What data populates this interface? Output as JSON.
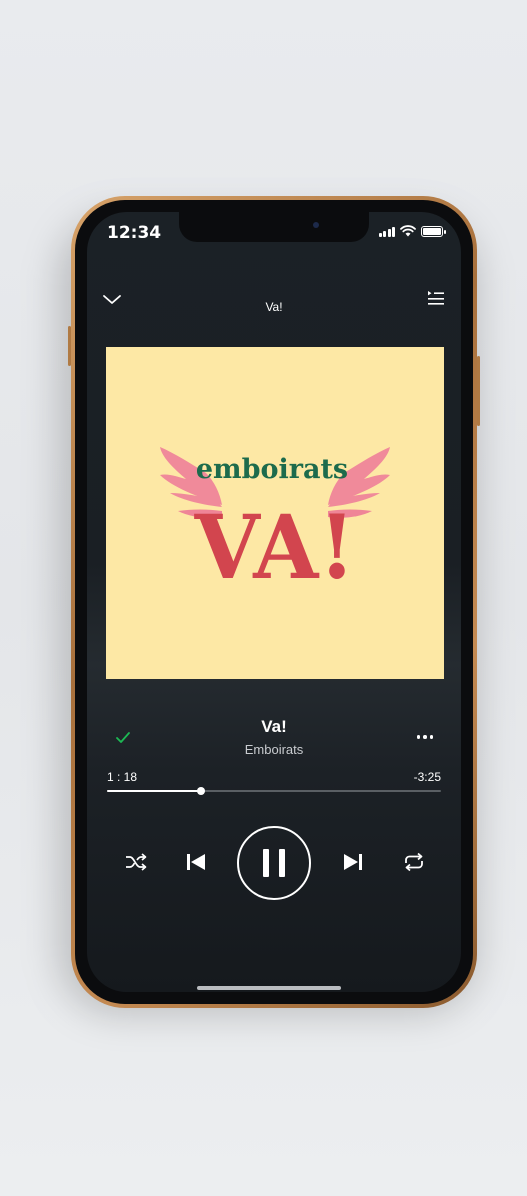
{
  "status_bar": {
    "time": "12:34"
  },
  "header": {
    "title": "Va!"
  },
  "album_art": {
    "brand_text": "emboirats",
    "title_text": "VA!",
    "background": "#fde8a5",
    "accent_red": "#d2454e",
    "accent_green": "#1d6b4c",
    "wing_pink": "#f08a9a"
  },
  "track": {
    "title": "Va!",
    "artist": "Emboirats",
    "liked": true
  },
  "progress": {
    "elapsed": "1 : 18",
    "remaining": "-3:25",
    "fraction": 0.28
  },
  "controls": {
    "shuffle": "shuffle-icon",
    "previous": "skip-back-icon",
    "play_pause": "pause-icon",
    "next": "skip-forward-icon",
    "repeat": "repeat-icon"
  },
  "colors": {
    "liked_check": "#1db954"
  }
}
